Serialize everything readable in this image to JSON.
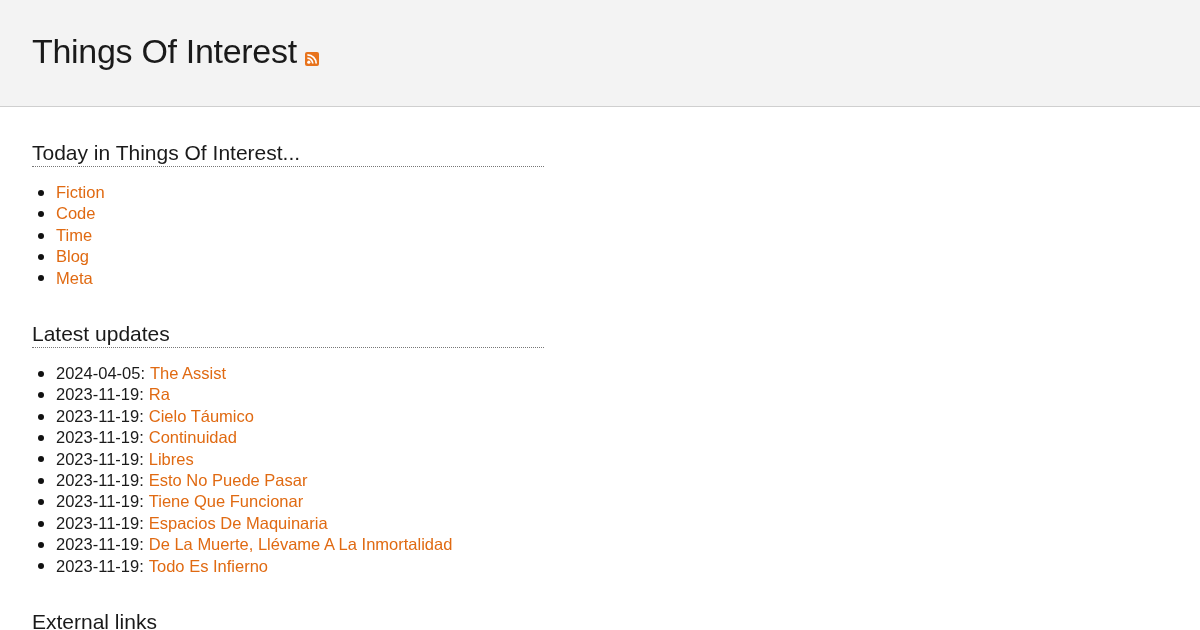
{
  "site": {
    "title": "Things Of Interest"
  },
  "sections": [
    {
      "kind": "links",
      "heading": "Today in Things Of Interest...",
      "items": [
        {
          "link": "Fiction"
        },
        {
          "link": "Code"
        },
        {
          "link": "Time"
        },
        {
          "link": "Blog"
        },
        {
          "link": "Meta"
        }
      ]
    },
    {
      "kind": "updates",
      "heading": "Latest updates",
      "items": [
        {
          "date": "2024-04-05:",
          "link": "The Assist"
        },
        {
          "date": "2023-11-19:",
          "link": "Ra"
        },
        {
          "date": "2023-11-19:",
          "link": "Cielo Táumico"
        },
        {
          "date": "2023-11-19:",
          "link": "Continuidad"
        },
        {
          "date": "2023-11-19:",
          "link": "Libres"
        },
        {
          "date": "2023-11-19:",
          "link": "Esto No Puede Pasar"
        },
        {
          "date": "2023-11-19:",
          "link": "Tiene Que Funcionar"
        },
        {
          "date": "2023-11-19:",
          "link": "Espacios De Maquinaria"
        },
        {
          "date": "2023-11-19:",
          "link": "De La Muerte, Llévame A La Inmortalidad"
        },
        {
          "date": "2023-11-19:",
          "link": "Todo Es Infierno"
        }
      ]
    },
    {
      "kind": "heading_only",
      "heading": "External links"
    }
  ]
}
